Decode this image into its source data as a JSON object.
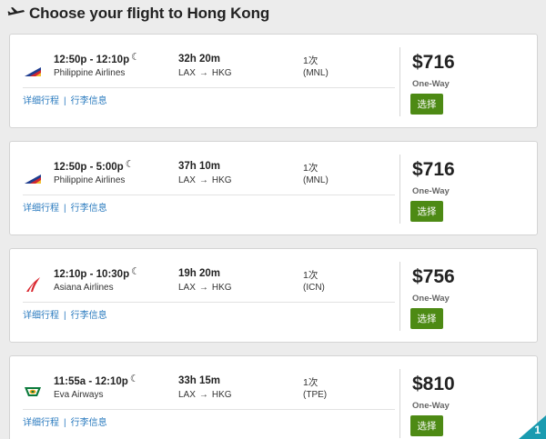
{
  "header": {
    "title": "Choose your flight to Hong Kong"
  },
  "flights": [
    {
      "logo": "philippine-airlines-logo",
      "times": "12:50p - 12:10p",
      "airline": "Philippine Airlines",
      "duration": "32h 20m",
      "from": "LAX",
      "to": "HKG",
      "stops": "1次",
      "via": "(MNL)",
      "details_link": "详细行程",
      "baggage_link": "行李信息",
      "price": "$716",
      "trip_type": "One-Way",
      "select_label": "选择"
    },
    {
      "logo": "philippine-airlines-logo",
      "times": "12:50p - 5:00p",
      "airline": "Philippine Airlines",
      "duration": "37h 10m",
      "from": "LAX",
      "to": "HKG",
      "stops": "1次",
      "via": "(MNL)",
      "details_link": "详细行程",
      "baggage_link": "行李信息",
      "price": "$716",
      "trip_type": "One-Way",
      "select_label": "选择"
    },
    {
      "logo": "asiana-airlines-logo",
      "times": "12:10p - 10:30p",
      "airline": "Asiana Airlines",
      "duration": "19h 20m",
      "from": "LAX",
      "to": "HKG",
      "stops": "1次",
      "via": "(ICN)",
      "details_link": "详细行程",
      "baggage_link": "行李信息",
      "price": "$756",
      "trip_type": "One-Way",
      "select_label": "选择"
    },
    {
      "logo": "eva-airways-logo",
      "times": "11:55a - 12:10p",
      "airline": "Eva Airways",
      "duration": "33h 15m",
      "from": "LAX",
      "to": "HKG",
      "stops": "1次",
      "via": "(TPE)",
      "details_link": "详细行程",
      "baggage_link": "行李信息",
      "price": "$810",
      "trip_type": "One-Way",
      "select_label": "选择"
    }
  ],
  "corner_badge": {
    "count": "1",
    "color": "#1a9bb0"
  },
  "colors": {
    "select_button": "#4d8a14",
    "link": "#2b7bbf"
  }
}
